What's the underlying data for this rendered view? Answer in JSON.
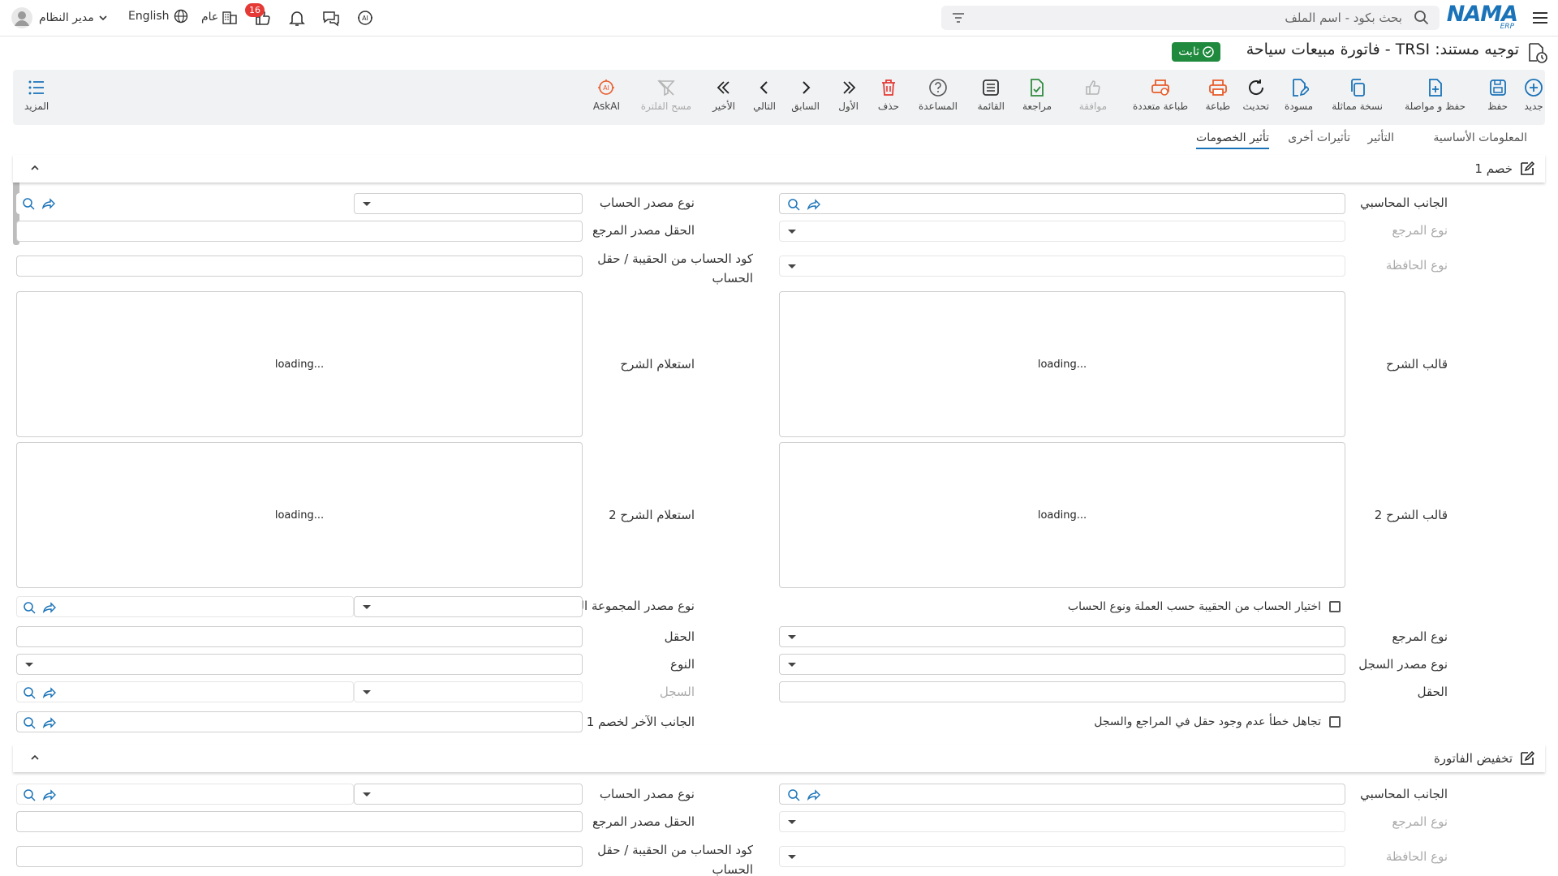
{
  "header": {
    "logo_text": "NAMA",
    "logo_sub": "ERP",
    "search_placeholder": "بحث بكود - اسم الملف",
    "badge_count": "16",
    "general_label": "عام",
    "language_label": "English",
    "user_name": "مدير النظام"
  },
  "page": {
    "title": "توجيه مستند: TRSI - فاتورة مبيعات سياحة",
    "status": "ثابت"
  },
  "toolbar": {
    "new": "جديد",
    "save": "حفظ",
    "save_continue": "حفظ و مواصلة",
    "duplicate": "نسخة مماثلة",
    "draft": "مسودة",
    "refresh": "تحديث",
    "print": "طباعة",
    "multi_print": "طباعة متعددة",
    "approve": "موافقة",
    "review": "مراجعة",
    "list": "القائمة",
    "help": "المساعدة",
    "delete": "حذف",
    "first": "الأول",
    "previous": "السابق",
    "next": "التالي",
    "last": "الأخير",
    "clear_filter": "مسح الفلترة",
    "askai": "AskAI",
    "more": "المزيد"
  },
  "tabs": {
    "basic": "المعلومات الأساسية",
    "effect": "التأثير",
    "other_effects": "تأثيرات أخرى",
    "discounts_effect": "تأثير الخصومات"
  },
  "section1": {
    "title": "خصم 1",
    "accounting_side": "الجانب المحاسبي",
    "account_source_type": "نوع مصدر الحساب",
    "ref_type": "نوع المرجع",
    "ref_source_field": "الحقل مصدر المرجع",
    "wallet_type": "نوع الحافظة",
    "account_code_line1": "كود الحساب من الحقيبة / حقل",
    "account_code_line2": "الحساب",
    "desc_template": "قالب الشرح",
    "desc_query": "استعلام الشرح",
    "desc_template2": "قالب الشرح 2",
    "desc_query2": "استعلام الشرح 2",
    "loading": "loading...",
    "choose_account_chk": "اختيار الحساب من الحقيبة حسب العملة ونوع الحساب",
    "analytic_group_source_type": "نوع مصدر المجموعة التحليلي",
    "ref_type2": "نوع المرجع",
    "field": "الحقل",
    "record_source_type": "نوع مصدر السجل",
    "type": "النوع",
    "field2": "الحقل",
    "record": "السجل",
    "ignore_error_chk": "تجاهل خطأ عدم وجود حقل في المراجع والسجل",
    "other_side": "الجانب الآخر لخصم 1"
  },
  "section2": {
    "title": "تخفيض الفاتورة",
    "accounting_side": "الجانب المحاسبي",
    "account_source_type": "نوع مصدر الحساب",
    "ref_type": "نوع المرجع",
    "ref_source_field": "الحقل مصدر المرجع",
    "wallet_type": "نوع الحافظة",
    "account_code_line1": "كود الحساب من الحقيبة / حقل",
    "account_code_line2": "الحساب"
  },
  "colors": {
    "accent": "#1a73b8",
    "status_green": "#1f8a3e",
    "badge_red": "#e53935",
    "icon_orange": "#e85d2c"
  }
}
